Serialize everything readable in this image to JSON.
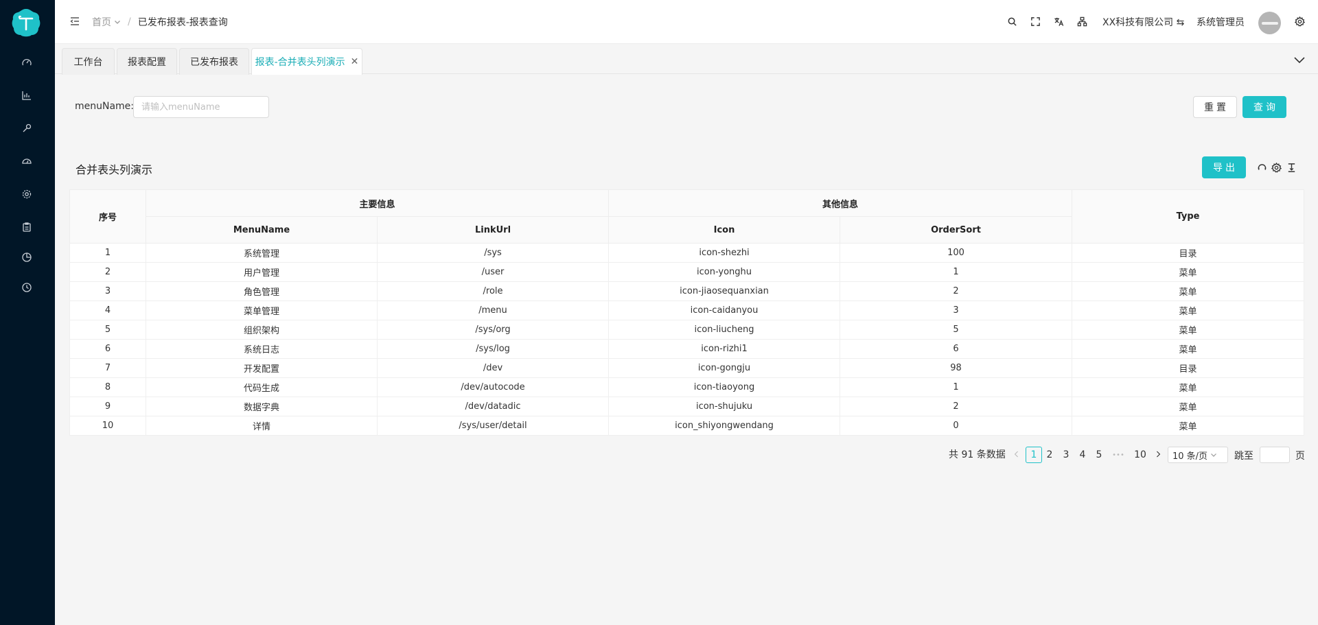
{
  "header": {
    "breadcrumb": [
      "首页",
      "已发布报表-报表查询"
    ],
    "company": "XX科技有限公司",
    "company_switch_icon": "⇆",
    "user": "系统管理员"
  },
  "tabs": [
    {
      "label": "工作台",
      "active": false
    },
    {
      "label": "报表配置",
      "active": false
    },
    {
      "label": "已发布报表",
      "active": false
    },
    {
      "label": "报表-合并表头列演示",
      "active": true,
      "close": "✕"
    }
  ],
  "search": {
    "label": "menuName:",
    "placeholder": "请输入menuName",
    "reset_label": "重置",
    "query_label": "查询"
  },
  "table": {
    "title": "合并表头列演示",
    "export_label": "导出",
    "headers": {
      "index": "序号",
      "group_main": "主要信息",
      "group_other": "其他信息",
      "menu_name": "MenuName",
      "link_url": "LinkUrl",
      "icon": "Icon",
      "order_sort": "OrderSort",
      "type": "Type"
    },
    "rows": [
      {
        "index": "1",
        "menu_name": "系统管理",
        "link_url": "/sys",
        "icon": "icon-shezhi",
        "order_sort": "100",
        "type": "目录"
      },
      {
        "index": "2",
        "menu_name": "用户管理",
        "link_url": "/user",
        "icon": "icon-yonghu",
        "order_sort": "1",
        "type": "菜单"
      },
      {
        "index": "3",
        "menu_name": "角色管理",
        "link_url": "/role",
        "icon": "icon-jiaosequanxian",
        "order_sort": "2",
        "type": "菜单"
      },
      {
        "index": "4",
        "menu_name": "菜单管理",
        "link_url": "/menu",
        "icon": "icon-caidanyou",
        "order_sort": "3",
        "type": "菜单"
      },
      {
        "index": "5",
        "menu_name": "组织架构",
        "link_url": "/sys/org",
        "icon": "icon-liucheng",
        "order_sort": "5",
        "type": "菜单"
      },
      {
        "index": "6",
        "menu_name": "系统日志",
        "link_url": "/sys/log",
        "icon": "icon-rizhi1",
        "order_sort": "6",
        "type": "菜单"
      },
      {
        "index": "7",
        "menu_name": "开发配置",
        "link_url": "/dev",
        "icon": "icon-gongju",
        "order_sort": "98",
        "type": "目录"
      },
      {
        "index": "8",
        "menu_name": "代码生成",
        "link_url": "/dev/autocode",
        "icon": "icon-tiaoyong",
        "order_sort": "1",
        "type": "菜单"
      },
      {
        "index": "9",
        "menu_name": "数据字典",
        "link_url": "/dev/datadic",
        "icon": "icon-shujuku",
        "order_sort": "2",
        "type": "菜单"
      },
      {
        "index": "10",
        "menu_name": "详情",
        "link_url": "/sys/user/detail",
        "icon": "icon_shiyongwendang",
        "order_sort": "0",
        "type": "菜单"
      }
    ]
  },
  "pagination": {
    "total_text": "共 91 条数据",
    "pages": [
      "1",
      "2",
      "3",
      "4",
      "5",
      "10"
    ],
    "ellipsis": "•••",
    "current": "1",
    "page_size": "10 条/页",
    "jump_label": "跳至",
    "page_unit": "页"
  },
  "colors": {
    "accent": "#1fc1c8",
    "sidebar_bg": "#011627",
    "active_tab_text": "#1aadb6"
  },
  "icons": {
    "sidebar": [
      "dashboard-icon",
      "chart-icon",
      "tool-icon",
      "speedometer-icon",
      "gear-icon",
      "clipboard-icon",
      "pie-chart-icon",
      "clock-icon"
    ],
    "header": [
      "search-icon",
      "fullscreen-icon",
      "translate-icon",
      "org-tree-icon",
      "settings-icon"
    ],
    "table_tools": [
      "refresh-icon",
      "settings-icon",
      "density-icon"
    ]
  }
}
